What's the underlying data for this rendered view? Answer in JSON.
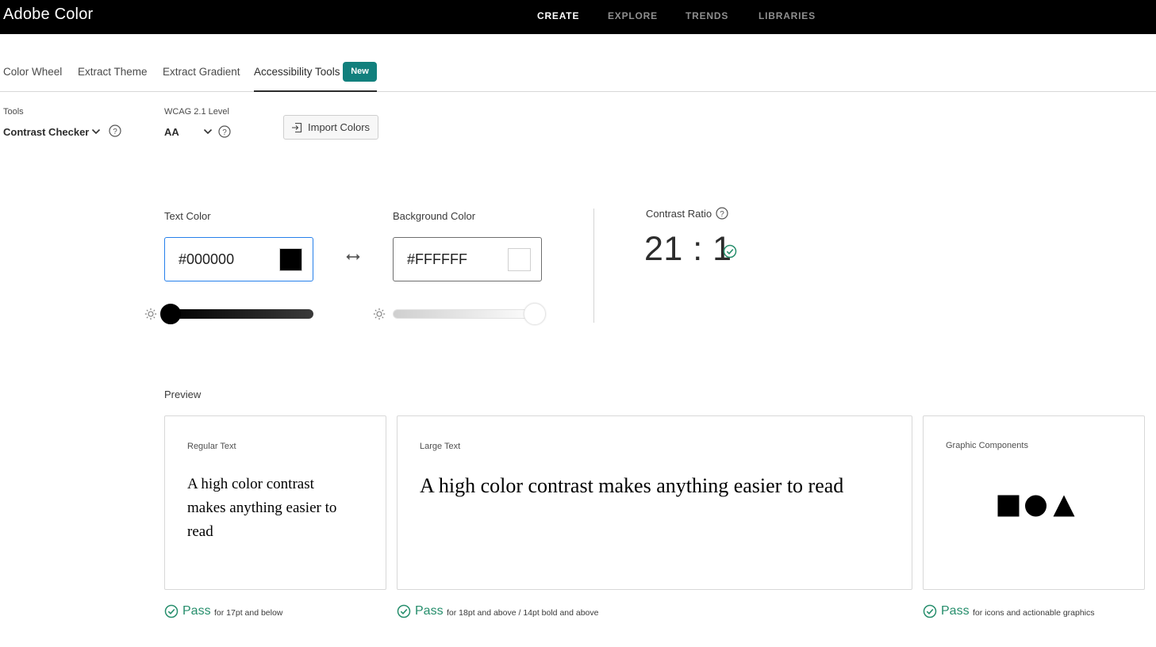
{
  "app": {
    "title": "Adobe Color"
  },
  "topnav": {
    "items": [
      {
        "label": "CREATE"
      },
      {
        "label": "EXPLORE"
      },
      {
        "label": "TRENDS"
      },
      {
        "label": "LIBRARIES"
      }
    ],
    "active": "CREATE"
  },
  "subtabs": {
    "items": [
      {
        "label": "Color Wheel"
      },
      {
        "label": "Extract Theme"
      },
      {
        "label": "Extract Gradient"
      },
      {
        "label": "Accessibility Tools"
      }
    ],
    "active": "Accessibility Tools",
    "badge": "New"
  },
  "tools": {
    "label": "Tools",
    "value": "Contrast Checker"
  },
  "wcag": {
    "label": "WCAG 2.1 Level",
    "value": "AA"
  },
  "import_button": {
    "label": "Import Colors"
  },
  "text_color": {
    "label": "Text Color",
    "hex": "#000000",
    "brightness": 0.0
  },
  "background_color": {
    "label": "Background Color",
    "hex": "#FFFFFF",
    "brightness": 1.0
  },
  "contrast": {
    "label": "Contrast Ratio",
    "value": "21 : 1",
    "status": "pass"
  },
  "preview": {
    "label": "Preview",
    "regular": {
      "title": "Regular Text",
      "sample": "A high color contrast makes anything easier to read",
      "result": "Pass",
      "note": "for 17pt and below"
    },
    "large": {
      "title": "Large Text",
      "sample": "A high color contrast makes anything easier to read",
      "result": "Pass",
      "note": "for 18pt and above / 14pt bold and above"
    },
    "graphic": {
      "title": "Graphic Components",
      "shapes": [
        "square",
        "circle",
        "triangle"
      ],
      "result": "Pass",
      "note": "for icons and actionable graphics"
    }
  },
  "colors": {
    "accent": "#12807d",
    "pass": "#268e6c",
    "focus": "#2680eb"
  }
}
